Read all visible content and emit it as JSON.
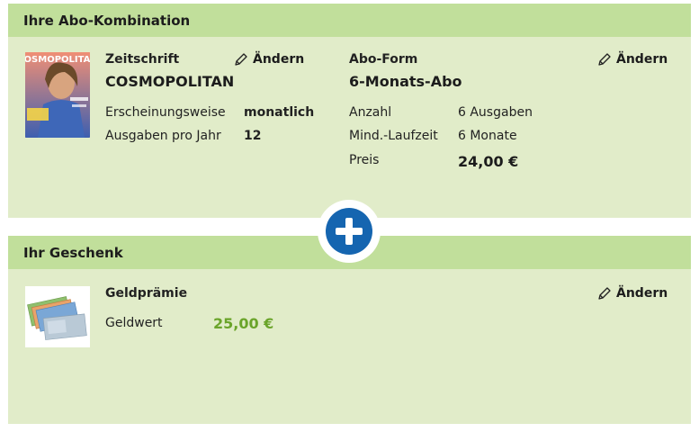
{
  "abo": {
    "header": "Ihre Abo-Kombination",
    "magazine": {
      "cover_title": "COSMOPOLITAN",
      "label": "Zeitschrift",
      "name": "COSMOPOLITAN",
      "edit": "Ändern",
      "rows": [
        {
          "key": "Erscheinungsweise",
          "value": "monatlich"
        },
        {
          "key": "Ausgaben pro Jahr",
          "value": "12"
        }
      ]
    },
    "form": {
      "label": "Abo-Form",
      "name": "6-Monats-Abo",
      "edit": "Ändern",
      "rows": [
        {
          "key": "Anzahl",
          "value": "6 Ausgaben"
        },
        {
          "key": "Mind.-Laufzeit",
          "value": "6 Monate"
        },
        {
          "key": "Preis",
          "value": "24,00 €"
        }
      ]
    }
  },
  "gift": {
    "header": "Ihr Geschenk",
    "label": "Geldprämie",
    "edit": "Ändern",
    "value_key": "Geldwert",
    "value": "25,00 €"
  },
  "colors": {
    "panel_bg": "#e1ecc9",
    "header_bg": "#c1df9b",
    "plus_blue": "#1565b0",
    "value_green": "#6aa42a"
  },
  "icons": {
    "edit": "pencil-icon",
    "combine": "plus-icon"
  }
}
